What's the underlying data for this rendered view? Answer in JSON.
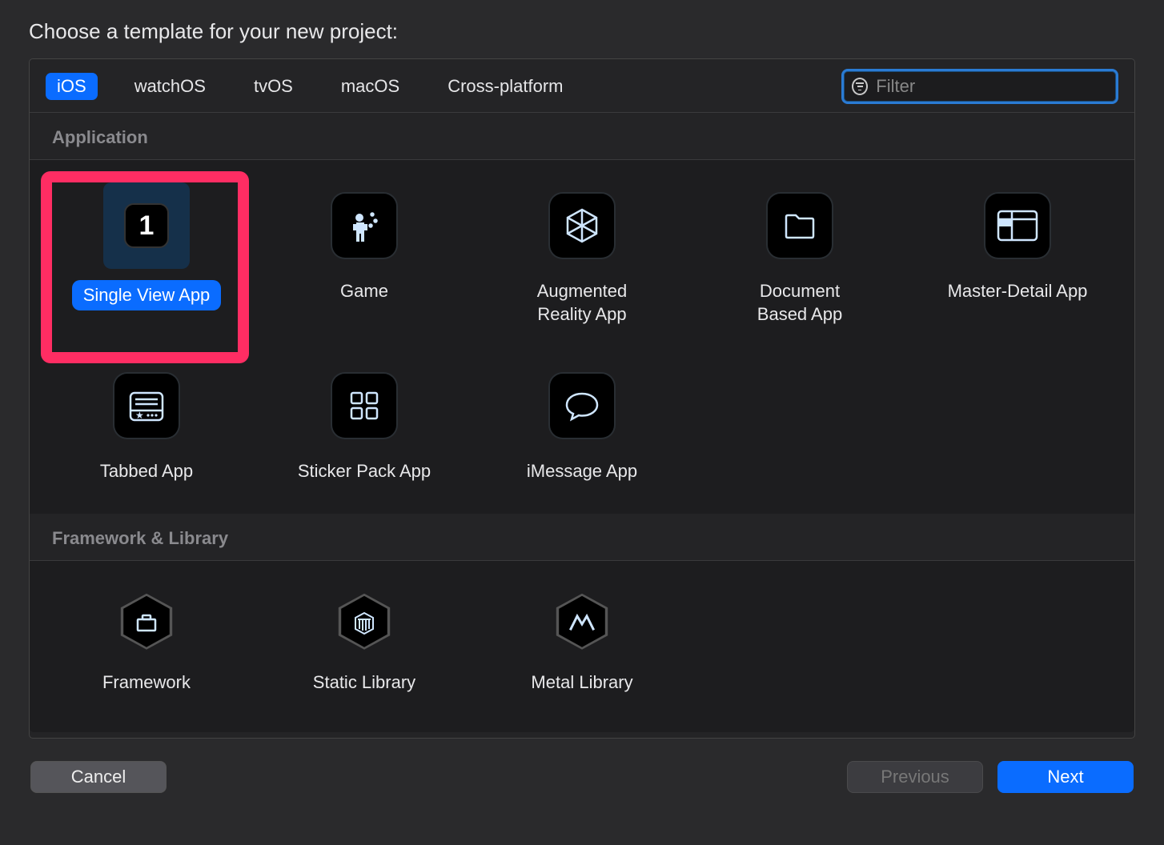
{
  "title": "Choose a template for your new project:",
  "tabs": [
    "iOS",
    "watchOS",
    "tvOS",
    "macOS",
    "Cross-platform"
  ],
  "selected_tab": "iOS",
  "filter": {
    "placeholder": "Filter",
    "value": ""
  },
  "sections": {
    "application": {
      "header": "Application",
      "items": [
        {
          "id": "single-view",
          "label": "Single View App",
          "selected": true,
          "badge": "1"
        },
        {
          "id": "game",
          "label": "Game"
        },
        {
          "id": "ar",
          "label": "Augmented\nReality App"
        },
        {
          "id": "document",
          "label": "Document\nBased App"
        },
        {
          "id": "master-detail",
          "label": "Master-Detail App"
        },
        {
          "id": "tabbed",
          "label": "Tabbed App"
        },
        {
          "id": "sticker",
          "label": "Sticker Pack App"
        },
        {
          "id": "imessage",
          "label": "iMessage App"
        }
      ]
    },
    "framework": {
      "header": "Framework & Library",
      "items": [
        {
          "id": "framework",
          "label": "Framework"
        },
        {
          "id": "static-lib",
          "label": "Static Library"
        },
        {
          "id": "metal-lib",
          "label": "Metal Library"
        }
      ]
    }
  },
  "buttons": {
    "cancel": "Cancel",
    "previous": "Previous",
    "next": "Next"
  }
}
